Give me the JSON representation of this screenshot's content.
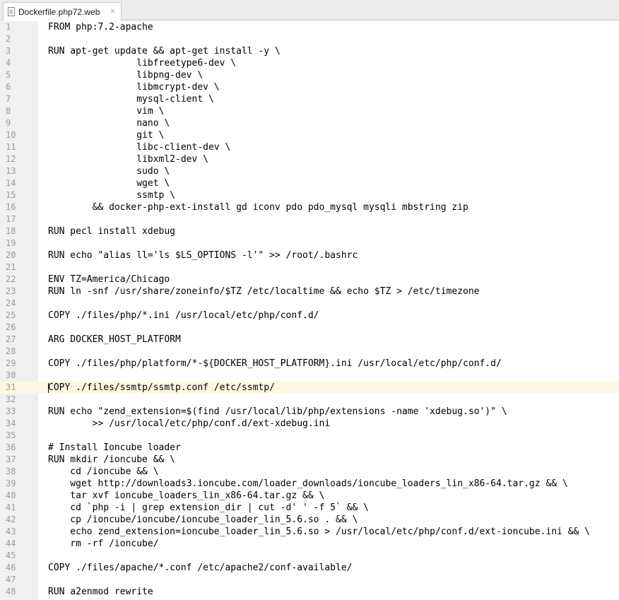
{
  "tab": {
    "label": "Dockerfile.php72.web",
    "close": "×"
  },
  "lines": [
    {
      "n": "1",
      "t": "FROM php:7.2-apache"
    },
    {
      "n": "2",
      "t": ""
    },
    {
      "n": "3",
      "t": "RUN apt-get update && apt-get install -y \\"
    },
    {
      "n": "4",
      "t": "                libfreetype6-dev \\"
    },
    {
      "n": "5",
      "t": "                libpng-dev \\"
    },
    {
      "n": "6",
      "t": "                libmcrypt-dev \\"
    },
    {
      "n": "7",
      "t": "                mysql-client \\"
    },
    {
      "n": "8",
      "t": "                vim \\"
    },
    {
      "n": "9",
      "t": "                nano \\"
    },
    {
      "n": "10",
      "t": "                git \\"
    },
    {
      "n": "11",
      "t": "                libc-client-dev \\"
    },
    {
      "n": "12",
      "t": "                libxml2-dev \\"
    },
    {
      "n": "13",
      "t": "                sudo \\"
    },
    {
      "n": "14",
      "t": "                wget \\"
    },
    {
      "n": "15",
      "t": "                ssmtp \\"
    },
    {
      "n": "16",
      "t": "        && docker-php-ext-install gd iconv pdo pdo_mysql mysqli mbstring zip"
    },
    {
      "n": "17",
      "t": ""
    },
    {
      "n": "18",
      "t": "RUN pecl install xdebug"
    },
    {
      "n": "19",
      "t": ""
    },
    {
      "n": "20",
      "t": "RUN echo \"alias ll='ls $LS_OPTIONS -l'\" >> /root/.bashrc"
    },
    {
      "n": "21",
      "t": ""
    },
    {
      "n": "22",
      "t": "ENV TZ=America/Chicago"
    },
    {
      "n": "23",
      "t": "RUN ln -snf /usr/share/zoneinfo/$TZ /etc/localtime && echo $TZ > /etc/timezone"
    },
    {
      "n": "24",
      "t": ""
    },
    {
      "n": "25",
      "t": "COPY ./files/php/*.ini /usr/local/etc/php/conf.d/"
    },
    {
      "n": "26",
      "t": ""
    },
    {
      "n": "27",
      "t": "ARG DOCKER_HOST_PLATFORM"
    },
    {
      "n": "28",
      "t": ""
    },
    {
      "n": "29",
      "t": "COPY ./files/php/platform/*-${DOCKER_HOST_PLATFORM}.ini /usr/local/etc/php/conf.d/"
    },
    {
      "n": "30",
      "t": ""
    },
    {
      "n": "31",
      "t": "COPY ./files/ssmtp/ssmtp.conf /etc/ssmtp/",
      "current": true
    },
    {
      "n": "32",
      "t": ""
    },
    {
      "n": "33",
      "t": "RUN echo \"zend_extension=$(find /usr/local/lib/php/extensions -name 'xdebug.so')\" \\"
    },
    {
      "n": "34",
      "t": "        >> /usr/local/etc/php/conf.d/ext-xdebug.ini"
    },
    {
      "n": "35",
      "t": ""
    },
    {
      "n": "36",
      "t": "# Install Ioncube loader"
    },
    {
      "n": "37",
      "t": "RUN mkdir /ioncube && \\"
    },
    {
      "n": "38",
      "t": "    cd /ioncube && \\"
    },
    {
      "n": "39",
      "t": "    wget http://downloads3.ioncube.com/loader_downloads/ioncube_loaders_lin_x86-64.tar.gz && \\"
    },
    {
      "n": "40",
      "t": "    tar xvf ioncube_loaders_lin_x86-64.tar.gz && \\"
    },
    {
      "n": "41",
      "t": "    cd `php -i | grep extension_dir | cut -d' ' -f 5` && \\"
    },
    {
      "n": "42",
      "t": "    cp /ioncube/ioncube/ioncube_loader_lin_5.6.so . && \\"
    },
    {
      "n": "43",
      "t": "    echo zend_extension=ioncube_loader_lin_5.6.so > /usr/local/etc/php/conf.d/ext-ioncube.ini && \\"
    },
    {
      "n": "44",
      "t": "    rm -rf /ioncube/"
    },
    {
      "n": "45",
      "t": ""
    },
    {
      "n": "46",
      "t": "COPY ./files/apache/*.conf /etc/apache2/conf-available/"
    },
    {
      "n": "47",
      "t": ""
    },
    {
      "n": "48",
      "t": "RUN a2enmod rewrite"
    }
  ]
}
